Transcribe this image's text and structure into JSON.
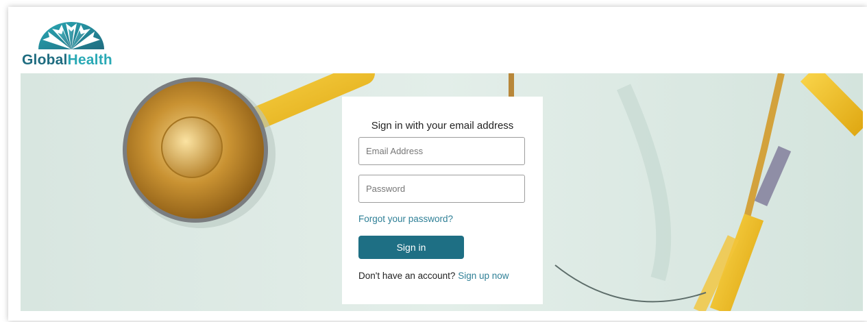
{
  "brand": {
    "name_part1": "Global",
    "name_part2": "Health",
    "colors": {
      "dark_teal": "#1f6c80",
      "teal": "#2aa9b5"
    },
    "icon": "sunburst-logo-icon"
  },
  "signin_card": {
    "title": "Sign in with your email address",
    "email_placeholder": "Email Address",
    "email_value": "",
    "password_placeholder": "Password",
    "password_value": "",
    "forgot_label": "Forgot your password?",
    "signin_label": "Sign in",
    "no_account_text": "Don't have an account?",
    "signup_label": "Sign up now",
    "button_color": "#1e6f84",
    "link_color": "#2e7f96"
  },
  "hero": {
    "image": "stethoscope-background",
    "background_color": "#dde9e4",
    "accent_color": "#f2c12e"
  }
}
